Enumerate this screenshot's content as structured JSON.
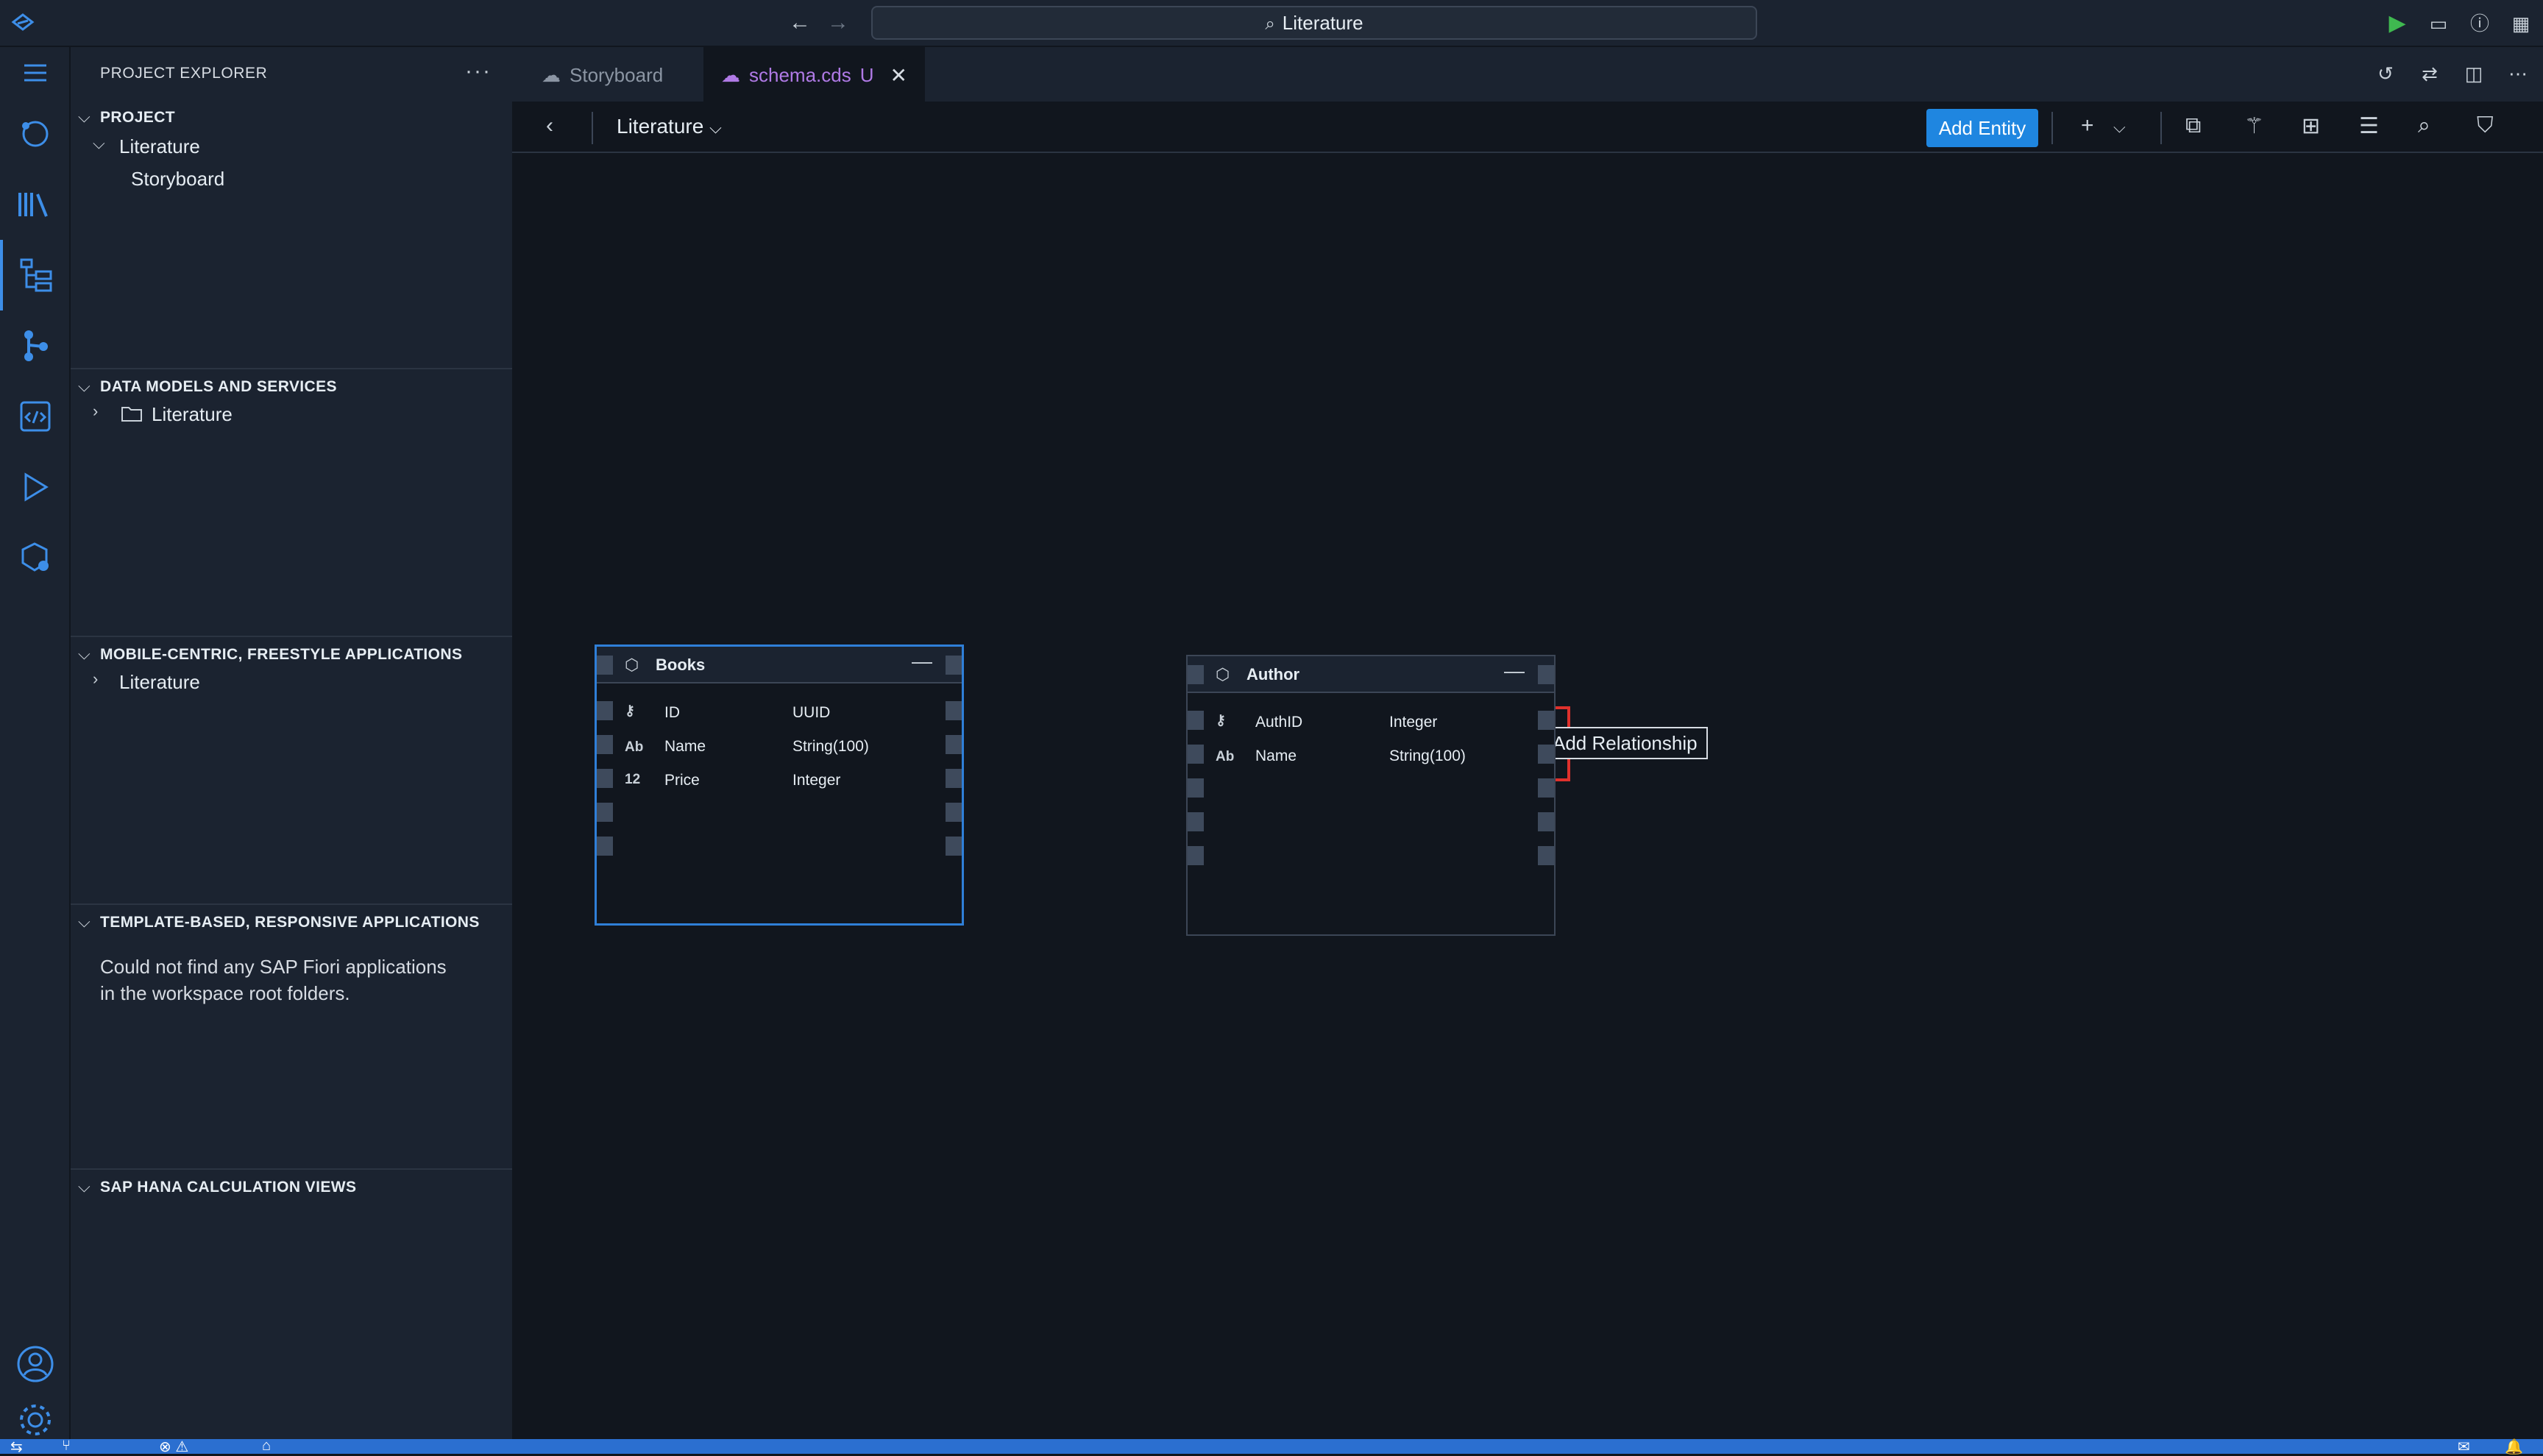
{
  "titlebar": {
    "search_text": "Literature",
    "icons": [
      "app-logo-icon",
      "back-arrow-icon",
      "forward-arrow-icon",
      "search-icon",
      "run-icon",
      "toggle-panel-icon",
      "help-icon",
      "layout-icon"
    ]
  },
  "activity_bar": {
    "items": [
      "explorer-icon",
      "library-icon",
      "project-tree-icon",
      "source-control-icon",
      "code-editor-icon",
      "run-debug-icon",
      "extensions-icon",
      "account-icon",
      "settings-icon"
    ]
  },
  "sidebar": {
    "header": "PROJECT EXPLORER",
    "sections": {
      "project": {
        "title": "PROJECT",
        "root": "Literature",
        "child": "Storyboard"
      },
      "data_models": {
        "title": "DATA MODELS AND SERVICES",
        "item": "Literature"
      },
      "mobile": {
        "title": "MOBILE-CENTRIC, FREESTYLE APPLICATIONS",
        "item": "Literature"
      },
      "template": {
        "title": "TEMPLATE-BASED, RESPONSIVE APPLICATIONS",
        "message_line1": "Could not find any SAP Fiori applications",
        "message_line2": "in the workspace root folders."
      },
      "hana": {
        "title": "SAP HANA CALCULATION VIEWS"
      }
    }
  },
  "tabs": [
    {
      "label": "Storyboard",
      "active": false
    },
    {
      "label": "schema.cds",
      "badge": "U",
      "active": true
    }
  ],
  "toolbar": {
    "breadcrumb": "Literature",
    "add_entity_label": "Add Entity"
  },
  "entities": {
    "books": {
      "title": "Books",
      "fields": [
        {
          "icon": "key-icon",
          "name": "ID",
          "type": "UUID"
        },
        {
          "icon_text": "Ab",
          "name": "Name",
          "type": "String(100)"
        },
        {
          "icon_text": "12",
          "name": "Price",
          "type": "Integer"
        }
      ]
    },
    "author": {
      "title": "Author",
      "fields": [
        {
          "icon": "key-icon",
          "name": "AuthID",
          "type": "Integer"
        },
        {
          "icon_text": "Ab",
          "name": "Name",
          "type": "String(100)"
        }
      ]
    }
  },
  "tooltip": {
    "text": "Add Relationship"
  },
  "colors": {
    "accent": "#1f86e0",
    "highlight": "#e0312c",
    "run": "#3fb950",
    "tab_active_text": "#b07ae6"
  }
}
